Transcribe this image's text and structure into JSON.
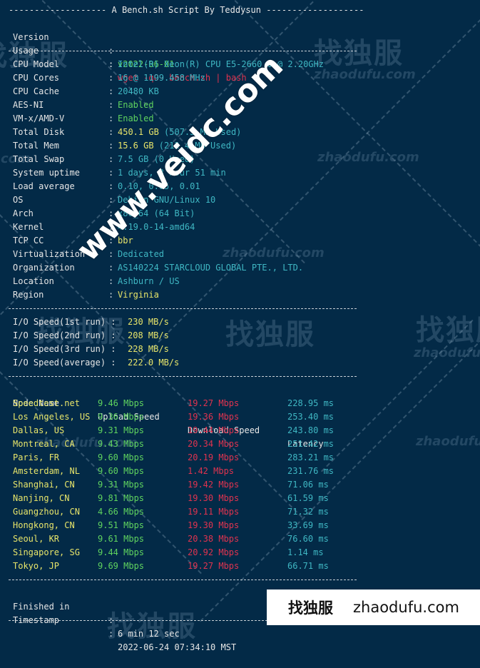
{
  "header": {
    "title": "------------------- A Bench.sh Script By Teddysun -------------------"
  },
  "intro": [
    {
      "label": "Version",
      "value": "v2022-06-01",
      "color": "green"
    },
    {
      "label": "Usage",
      "value": "wget -qO- bench.sh | bash",
      "color": "red"
    }
  ],
  "system": [
    {
      "label": "CPU Model",
      "value": "Intel(R) Xeon(R) CPU E5-2660 0 @ 2.20GHz",
      "color": "cyan"
    },
    {
      "label": "CPU Cores",
      "value": "16 @ 1199.458 MHz",
      "color": "cyan"
    },
    {
      "label": "CPU Cache",
      "value": "20480 KB",
      "color": "cyan"
    },
    {
      "label": "AES-NI",
      "value": "Enabled",
      "color": "green"
    },
    {
      "label": "VM-x/AMD-V",
      "value": "Enabled",
      "color": "green"
    },
    {
      "label": "Total Disk",
      "value": "450.1 GB",
      "extra": " (507.3 MB Used)",
      "color": "yellow"
    },
    {
      "label": "Total Mem",
      "value": "15.6 GB",
      "extra": " (212.4 MB Used)",
      "color": "yellow"
    },
    {
      "label": "Total Swap",
      "value": "7.5 GB (0 Used)",
      "color": "cyan"
    },
    {
      "label": "System uptime",
      "value": "1 days, 3 hour 51 min",
      "color": "cyan"
    },
    {
      "label": "Load average",
      "value": "0.10, 0.05, 0.01",
      "color": "cyan"
    },
    {
      "label": "OS",
      "value": "Debian GNU/Linux 10",
      "color": "cyan"
    },
    {
      "label": "Arch",
      "value": "x86_64 (64 Bit)",
      "color": "cyan"
    },
    {
      "label": "Kernel",
      "value": "4.19.0-14-amd64",
      "color": "cyan"
    },
    {
      "label": "TCP CC",
      "value": "bbr",
      "color": "yellow"
    },
    {
      "label": "Virtualization",
      "value": "Dedicated",
      "color": "cyan"
    },
    {
      "label": "Organization",
      "value": "AS140224 STARCLOUD GLOBAL PTE., LTD.",
      "color": "cyan"
    },
    {
      "label": "Location",
      "value": "Ashburn / US",
      "color": "cyan"
    },
    {
      "label": "Region",
      "value": "Virginia",
      "color": "yellow"
    }
  ],
  "io": [
    {
      "label": "I/O Speed(1st run) :",
      "value": "230 MB/s"
    },
    {
      "label": "I/O Speed(2nd run) :",
      "value": "208 MB/s"
    },
    {
      "label": "I/O Speed(3rd run) :",
      "value": "228 MB/s"
    },
    {
      "label": "I/O Speed(average) :",
      "value": "222.0 MB/s"
    }
  ],
  "speedtest": {
    "headers": [
      "Node Name",
      "Upload Speed",
      "Download Speed",
      "Latency"
    ],
    "rows": [
      {
        "node": "Speedtest.net",
        "upload": "9.46 Mbps",
        "download": "19.27 Mbps",
        "latency": "228.95 ms"
      },
      {
        "node": "Los Angeles, US",
        "upload": "9.36 Mbps",
        "download": "19.36 Mbps",
        "latency": "253.40 ms"
      },
      {
        "node": "Dallas, US",
        "upload": "9.31 Mbps",
        "download": "19.44 Mbps",
        "latency": "243.80 ms"
      },
      {
        "node": "Montreal, CA",
        "upload": "9.43 Mbps",
        "download": "20.34 Mbps",
        "latency": "251.42 ms"
      },
      {
        "node": "Paris, FR",
        "upload": "9.60 Mbps",
        "download": "20.19 Mbps",
        "latency": "283.21 ms"
      },
      {
        "node": "Amsterdam, NL",
        "upload": "9.60 Mbps",
        "download": "1.42 Mbps",
        "latency": "231.76 ms"
      },
      {
        "node": "Shanghai, CN",
        "upload": "9.31 Mbps",
        "download": "19.42 Mbps",
        "latency": "71.06 ms"
      },
      {
        "node": "Nanjing, CN",
        "upload": "9.81 Mbps",
        "download": "19.30 Mbps",
        "latency": "61.59 ms"
      },
      {
        "node": "Guangzhou, CN",
        "upload": "4.66 Mbps",
        "download": "19.11 Mbps",
        "latency": "71.32 ms"
      },
      {
        "node": "Hongkong, CN",
        "upload": "9.51 Mbps",
        "download": "19.30 Mbps",
        "latency": "33.69 ms"
      },
      {
        "node": "Seoul, KR",
        "upload": "9.61 Mbps",
        "download": "20.38 Mbps",
        "latency": "76.60 ms"
      },
      {
        "node": "Singapore, SG",
        "upload": "9.44 Mbps",
        "download": "20.92 Mbps",
        "latency": "1.14 ms"
      },
      {
        "node": "Tokyo, JP",
        "upload": "9.69 Mbps",
        "download": "19.27 Mbps",
        "latency": "66.71 ms"
      }
    ]
  },
  "footer": [
    {
      "label": "Finished in",
      "value": "6 min 12 sec"
    },
    {
      "label": "Timestamp",
      "value": "2022-06-24 07:34:10 MST"
    }
  ],
  "watermarks": {
    "site_overlay": "www.veidc.com",
    "brand_cn": "找独服",
    "brand_en": "zhaodufu.com"
  },
  "colors": {
    "background": "#032a47",
    "green": "#5fd35f",
    "red": "#e0334f",
    "cyan": "#3fb7c3",
    "yellow": "#e8e56a"
  }
}
